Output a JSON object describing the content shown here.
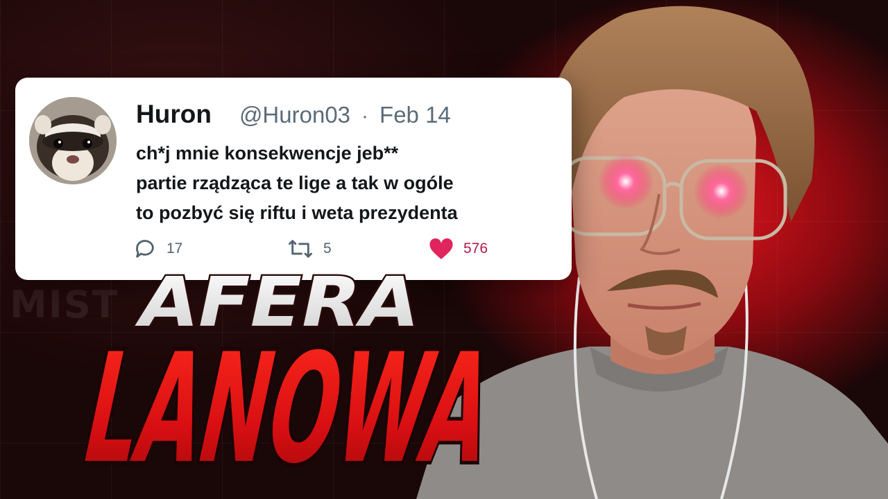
{
  "tweet": {
    "name": "Huron",
    "handle": "@Huron03",
    "separator": "·",
    "date": "Feb 14",
    "lines": [
      "ch*j mnie konsekwencje jeb**",
      "partie rządząca te lige a tak w ogóle",
      "to pozbyć się riftu i weta prezydenta"
    ],
    "replies": "17",
    "retweets": "5",
    "likes": "576"
  },
  "title": {
    "line1": "AFERA",
    "line2": "LANOWA"
  },
  "background_watermark": "MIST",
  "colors": {
    "accent_red": "#e0141e",
    "like_pink": "#e0245e",
    "eye_glow": "#ff2e6e"
  },
  "icons": [
    "reply-icon",
    "retweet-icon",
    "heart-icon"
  ]
}
